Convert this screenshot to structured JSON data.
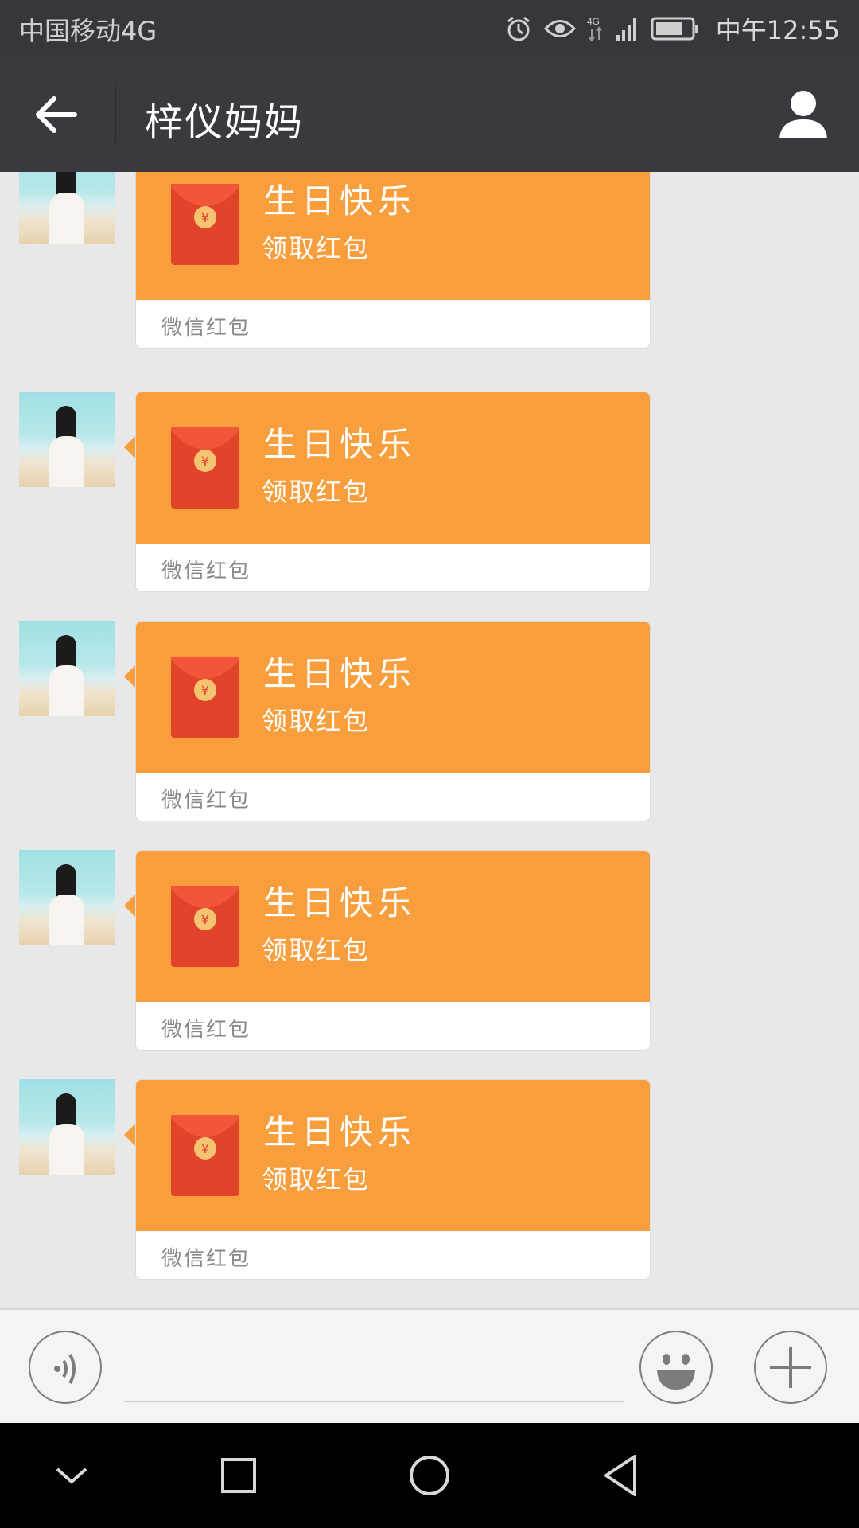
{
  "status_bar": {
    "carrier": "中国移动4G",
    "network_badge": "4G",
    "time": "中午12:55",
    "icons": [
      "alarm-icon",
      "eye-icon",
      "network-4g-icon",
      "signal-icon",
      "battery-icon"
    ]
  },
  "header": {
    "title": "梓仪妈妈",
    "back_icon": "back-arrow-icon",
    "profile_icon": "person-icon"
  },
  "messages": [
    {
      "greeting": "生日快乐",
      "action": "领取红包",
      "brand": "微信红包"
    },
    {
      "greeting": "生日快乐",
      "action": "领取红包",
      "brand": "微信红包"
    },
    {
      "greeting": "生日快乐",
      "action": "领取红包",
      "brand": "微信红包"
    },
    {
      "greeting": "生日快乐",
      "action": "领取红包",
      "brand": "微信红包"
    },
    {
      "greeting": "生日快乐",
      "action": "领取红包",
      "brand": "微信红包"
    }
  ],
  "input_bar": {
    "value": "",
    "placeholder": "",
    "buttons": [
      "voice-icon",
      "emoji-icon",
      "plus-icon"
    ]
  },
  "nav_bar": {
    "buttons": [
      "chevron-down-icon",
      "square-icon",
      "circle-icon",
      "triangle-back-icon"
    ]
  },
  "colors": {
    "status_bar": "#36363b",
    "title_bar": "#393a3f",
    "chat_bg": "#e8e8e8",
    "packet_orange": "#f99e3c",
    "envelope_red": "#e2442b",
    "coin_gold": "#f4c470"
  }
}
